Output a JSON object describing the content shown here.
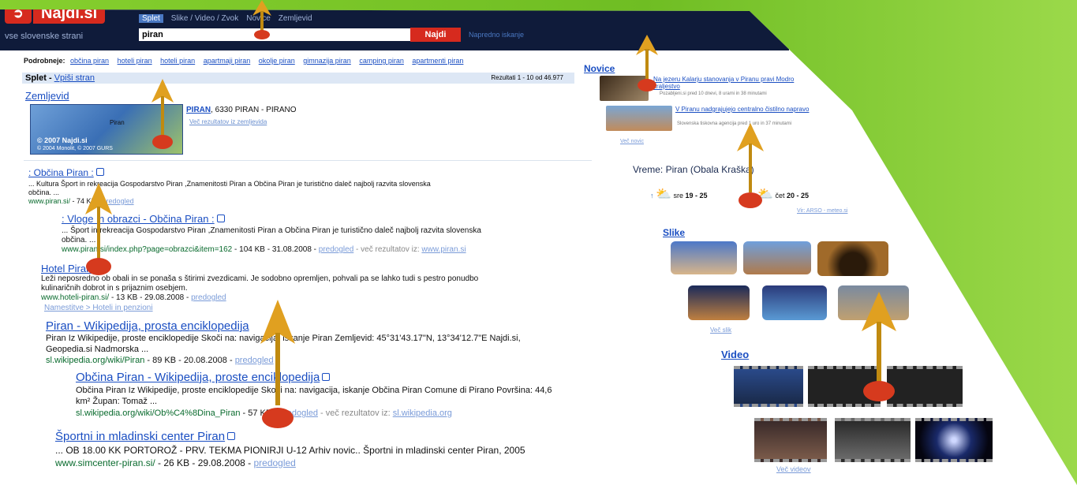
{
  "header": {
    "logo_text": "Najdi.si",
    "tagline": "vse slovenske strani",
    "tabs": [
      "Splet",
      "Slike / Video / Zvok",
      "Novice",
      "Zemljevid"
    ],
    "search_value": "piran",
    "search_button": "Najdi",
    "advanced": "Napredno iskanje"
  },
  "podrobneje": {
    "label": "Podrobneje:",
    "links": [
      "občina piran",
      "hoteli piran",
      "hoteli piran",
      "apartmaji piran",
      "okolje piran",
      "gimnazija piran",
      "camping piran",
      "apartmenti piran"
    ]
  },
  "splet": {
    "title": "Splet",
    "link": "Vpiši stran",
    "results": "Rezultati 1 - 10 od 46.977"
  },
  "zemljevid": {
    "title": "Zemljevid",
    "copyright": "© 2007 Najdi.si",
    "copyright2": "© 2004 Monolit, © 2007 GURS",
    "map_label": "Piran",
    "address_bold": "PIRAN",
    "address_rest": ", 6330 PIRAN - PIRANO",
    "more": "Več rezultatov iz zemljevida"
  },
  "results": [
    {
      "title": ": Občina Piran :",
      "snippet": "... Kultura Šport in rekreacija Gospodarstvo Piran ,Znamenitosti Piran a Občina Piran je turistično daleč najbolj razvita slovenska",
      "snippet2": "občina. ...",
      "url": "www.piran.si/",
      "size": "74 KB",
      "preview": "predogled"
    },
    {
      "title": ": Vloge in obrazci - Občina Piran :",
      "snippet": "... Šport in rekreacija Gospodarstvo Piran ,Znamenitosti Piran a Občina Piran je turistično daleč najbolj razvita slovenska",
      "snippet2": "občina. ...",
      "url": "www.piran.si/index.php?page=obrazci&item=162",
      "meta": "- 104 KB - 31.08.2008 -",
      "preview": "predogled",
      "more": "- več rezultatov iz:",
      "more_url": "www.piran.si"
    },
    {
      "title": "Hotel Piran",
      "snippet": "Leži neposredno ob obali in se ponaša s štirimi zvezdicami. Je sodobno opremljen, pohvali pa se lahko tudi s pestro ponudbo",
      "snippet2": "kulinaričnih dobrot in s prijaznim osebjem.",
      "url": "www.hoteli-piran.si/",
      "meta": "- 13 KB - 29.08.2008 -",
      "preview": "predogled",
      "crumb": "Namestitve > Hoteli in penzioni"
    },
    {
      "title": "Piran - Wikipedija, prosta enciklopedija",
      "snippet": "Piran Iz Wikipedije, proste enciklopedije Skoči na: navigacija, iskanje Piran Zemljevid: 45°31'43.17\"N, 13°34'12.7\"E Najdi.si,",
      "snippet2": "Geopedia.si Nadmorska ...",
      "url": "sl.wikipedia.org/wiki/Piran",
      "meta": "- 89 KB - 20.08.2008 -",
      "preview": "predogled"
    },
    {
      "title": "Občina Piran - Wikipedija, proste enciklopedija",
      "snippet": "Občina Piran Iz Wikipedije, proste enciklopedije Skoči na: navigacija, iskanje Občina Piran Comune di Pirano Površina: 44,6",
      "snippet2": "km² Župan: Tomaž ...",
      "url": "sl.wikipedia.org/wiki/Ob%C4%8Dina_Piran",
      "meta": "- 57 KB -",
      "preview": "predogled",
      "more": "- več rezultatov iz:",
      "more_url": "sl.wikipedia.org"
    },
    {
      "title": "Športni in mladinski center Piran",
      "snippet": "... OB 18.00 KK PORTOROŽ - PRV. TEKMA PIONIRJI U-12 Arhiv novic.. Športni in mladinski center Piran, 2005",
      "url": "www.simcenter-piran.si/",
      "meta": "- 26 KB - 29.08.2008 -",
      "preview": "predogled"
    }
  ],
  "sidebar": {
    "novice_title": "Novice",
    "news": [
      {
        "title": "Na jezeru Kalarju stanovanja v Piranu pravi Modro kraljestvo",
        "meta": "Pozabljeni.si pred 10 dnevi, 8 urami in 38 minutami"
      },
      {
        "title": "V Piranu nadgrajujejo centralno čistilno napravo",
        "meta": "Slovenska tiskovna agencija pred 1 uro in 37 minutami"
      }
    ],
    "news_more": "Več novic",
    "vreme_title": "Vreme: Piran (Obala Kraška)",
    "weather": [
      {
        "day": "sre",
        "temp": "19 - 25"
      },
      {
        "day": "čet",
        "temp": "20 - 25"
      }
    ],
    "weather_src": "Vir: ARSO - meteo.si",
    "slike_title": "Slike",
    "slike_more": "Več slik",
    "video_title": "Video",
    "video_more": "Več videov"
  },
  "colors": {
    "bg": "#7cc62a",
    "header": "#0f1b3a",
    "brand_red": "#d62a1e",
    "link": "#1a4ec2",
    "url_green": "#0a6b2e"
  }
}
